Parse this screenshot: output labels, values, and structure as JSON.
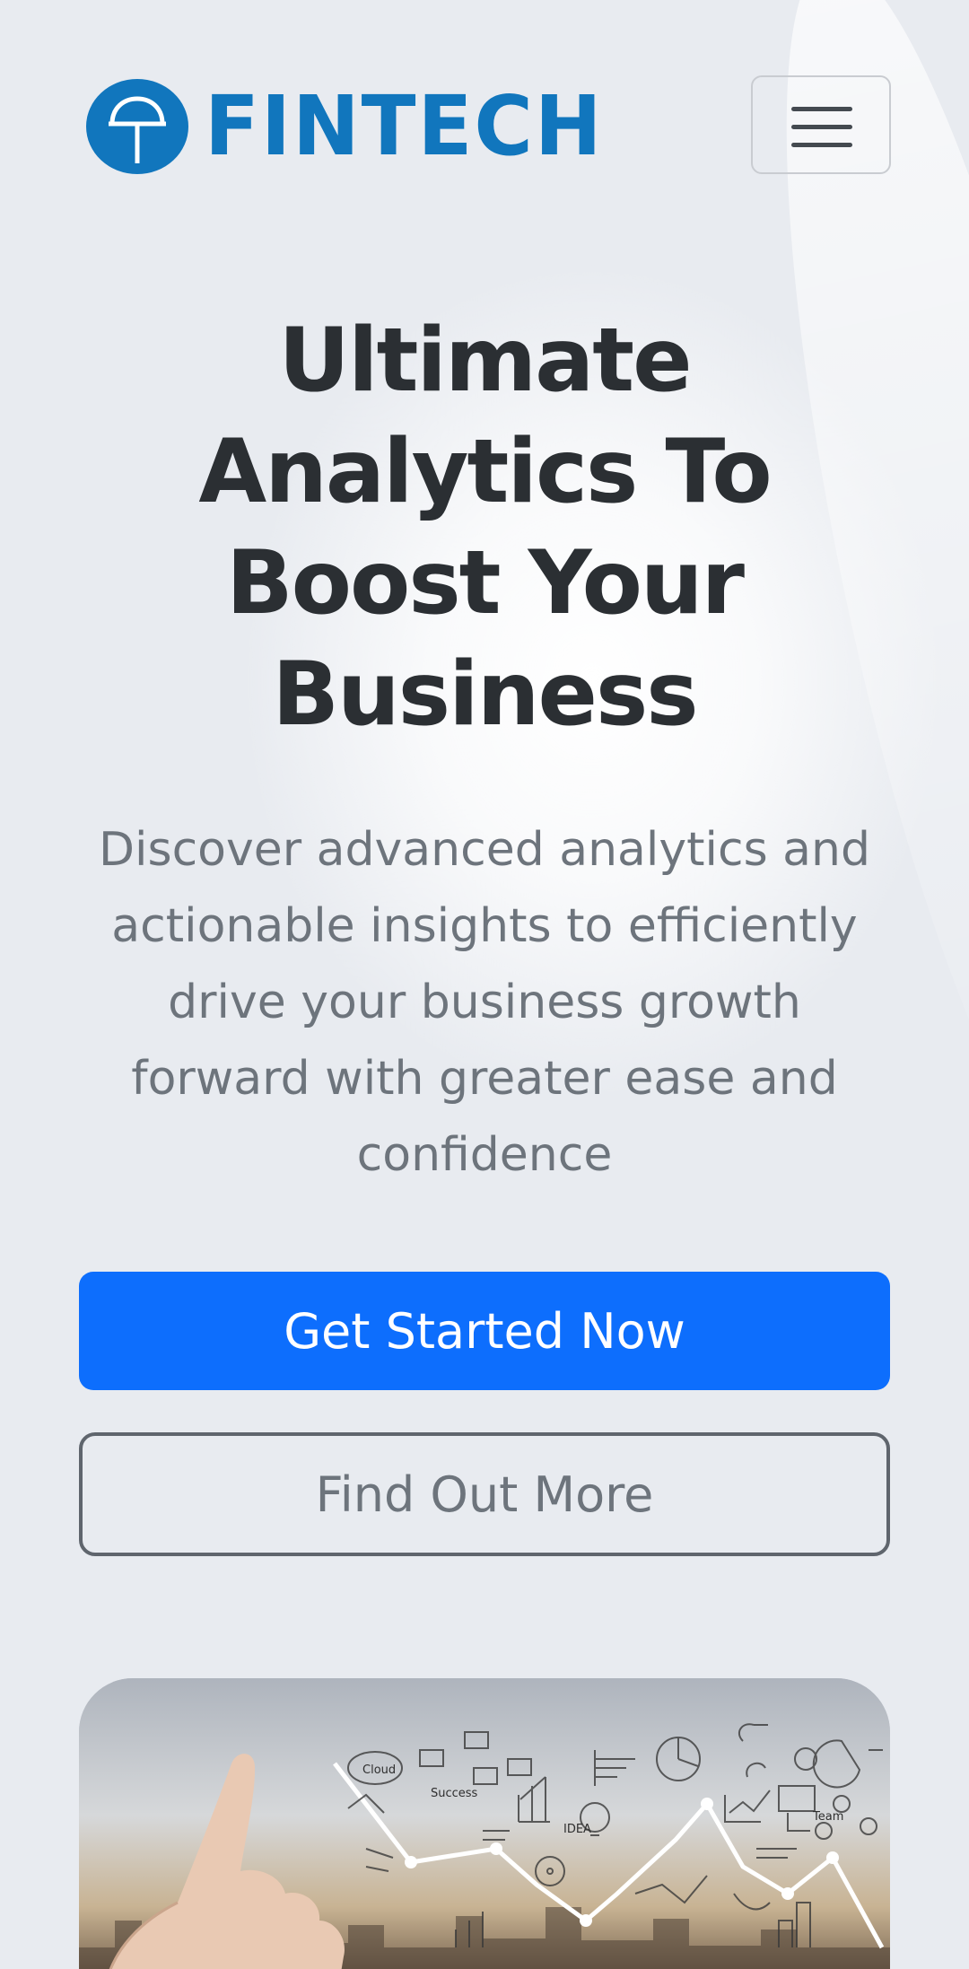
{
  "brand": {
    "name": "FINTECH",
    "logo_icon": "circle-parachute-logo-icon",
    "color": "#1176bd"
  },
  "navbar": {
    "toggle_icon": "hamburger-menu-icon"
  },
  "hero": {
    "title_lines": [
      "Ultimate",
      "Analytics To",
      "Boost Your",
      "Business"
    ],
    "subtitle_lines": [
      "Discover advanced analytics and",
      "actionable insights to efficiently",
      "drive your business growth",
      "forward with greater ease and",
      "confidence"
    ],
    "primary_button": "Get Started Now",
    "secondary_button": "Find Out More",
    "image_sketch_labels": [
      "Cloud",
      "Success",
      "IDEA",
      "Team"
    ]
  },
  "colors": {
    "primary": "#0d6efd",
    "heading": "#2b2f33",
    "muted": "#6d747c",
    "background": "#e8ebf0"
  }
}
